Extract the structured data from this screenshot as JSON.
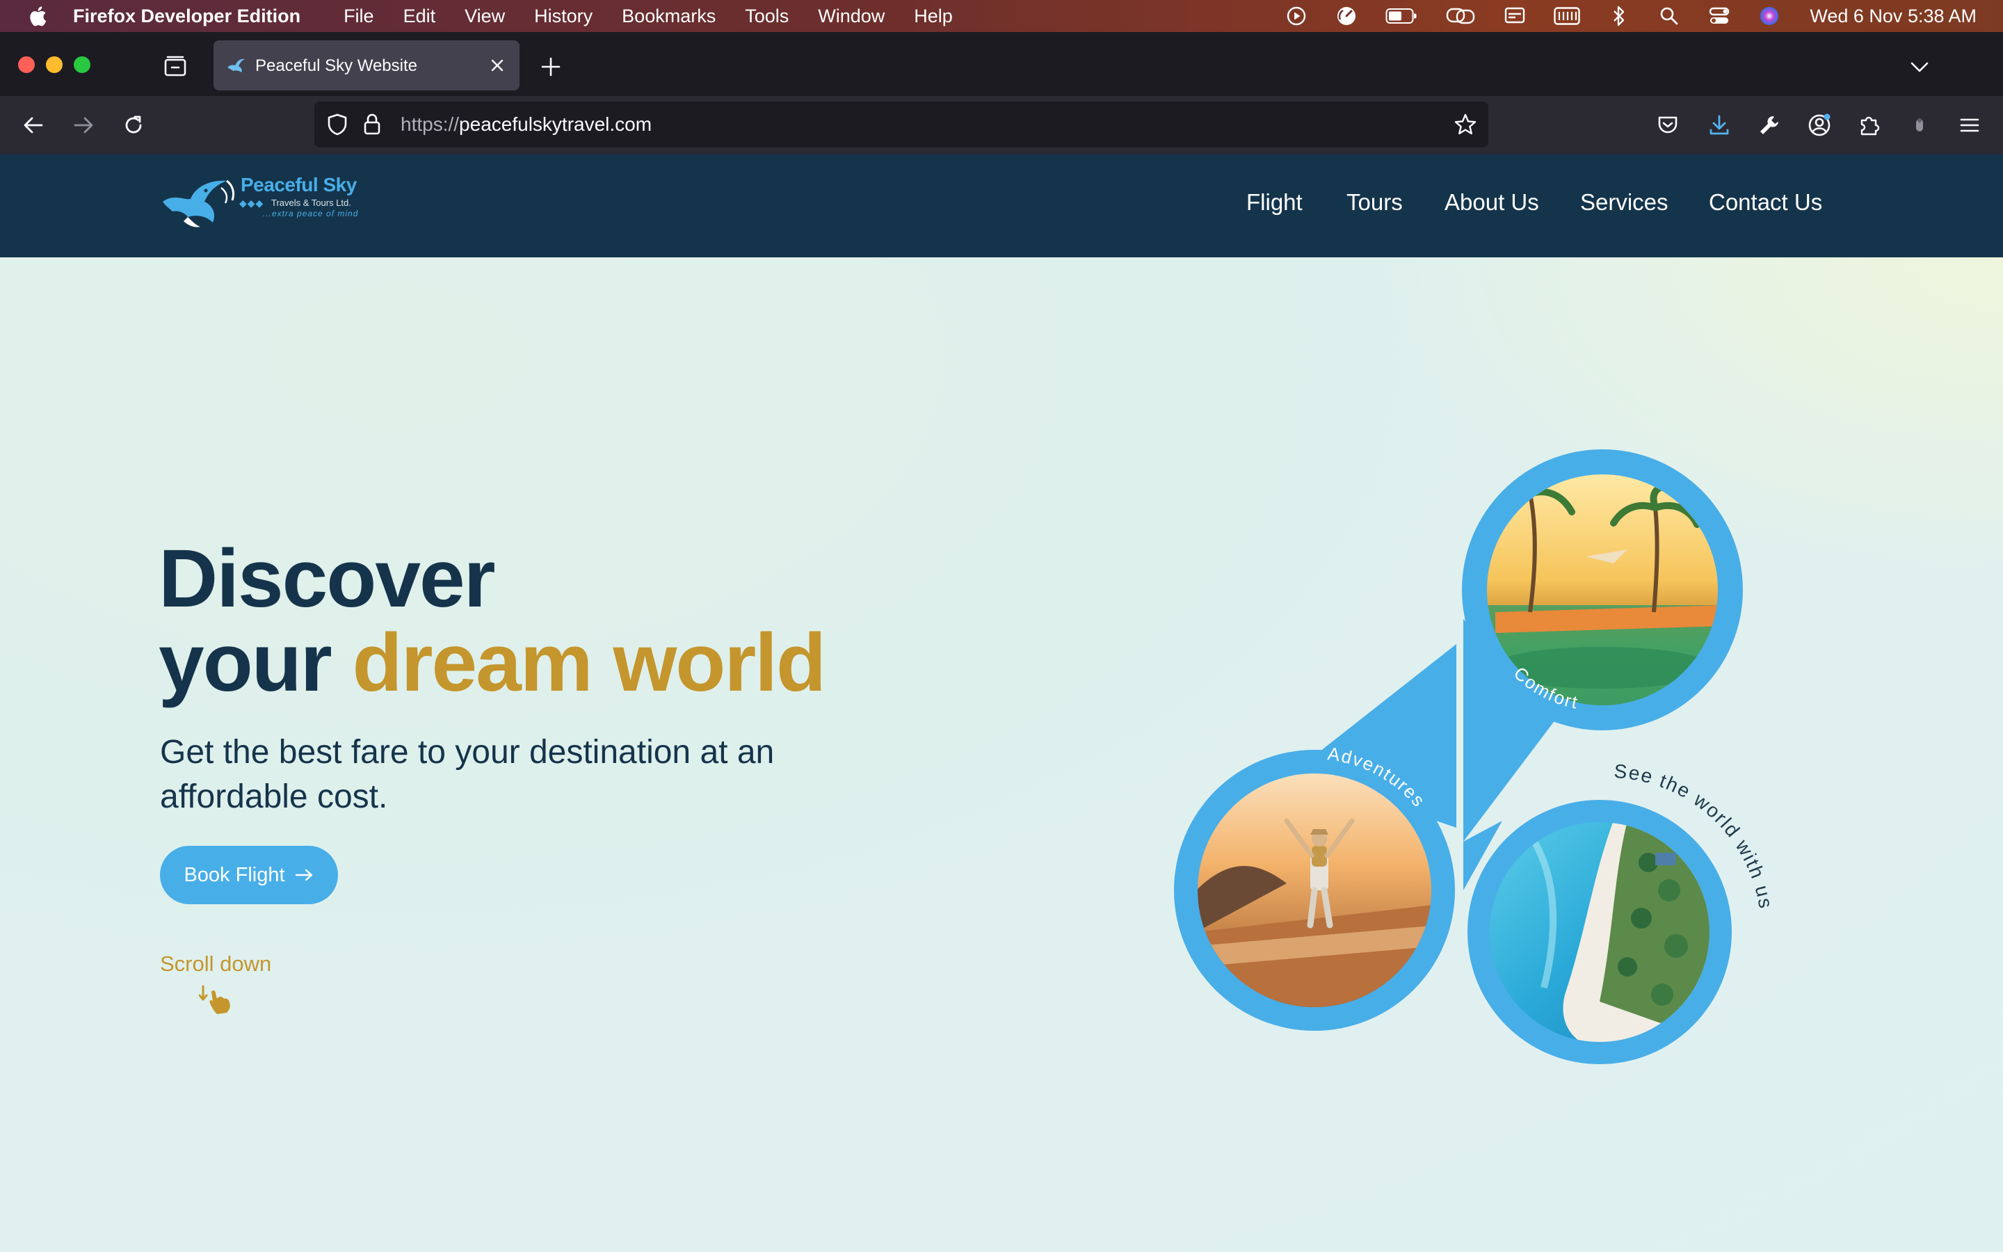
{
  "menubar": {
    "app_name": "Firefox Developer Edition",
    "menus": [
      "File",
      "Edit",
      "View",
      "History",
      "Bookmarks",
      "Tools",
      "Window",
      "Help"
    ],
    "clock": "Wed 6 Nov  5:38 AM"
  },
  "browser": {
    "tab_title": "Peaceful Sky Website",
    "url_scheme": "https://",
    "url_host": "peacefulskytravel.com"
  },
  "site": {
    "logo": {
      "name": "Peaceful Sky",
      "subtitle": "Travels & Tours Ltd.",
      "tagline": "...extra peace of mind"
    },
    "nav": [
      "Flight",
      "Tours",
      "About Us",
      "Services",
      "Contact Us"
    ],
    "hero": {
      "headline_line1": "Discover",
      "headline_line2_plain": "your ",
      "headline_line2_accent": "dream world",
      "subtext": "Get the best fare to your destination at an affordable cost.",
      "button_label": "Book Flight",
      "scroll_label": "Scroll down",
      "circle_labels": {
        "comfort": "Comfort",
        "adventures": "Adventures",
        "world": "See the world with us"
      }
    }
  },
  "colors": {
    "navy": "#14344b",
    "accent_blue": "#48aee8",
    "gold": "#c4962d"
  }
}
